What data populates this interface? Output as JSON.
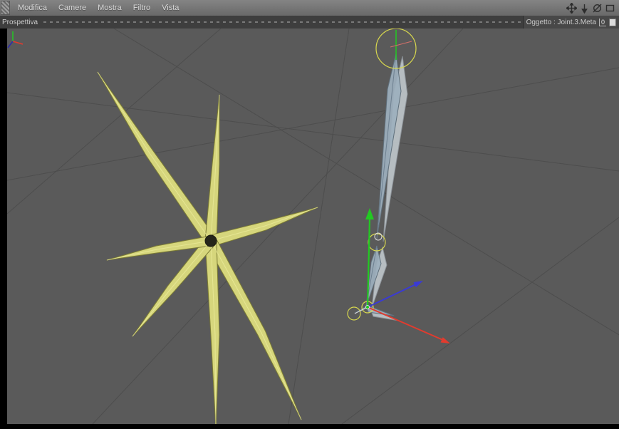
{
  "menubar": {
    "items": [
      {
        "label": "Modifica"
      },
      {
        "label": "Camere"
      },
      {
        "label": "Mostra"
      },
      {
        "label": "Filtro"
      },
      {
        "label": "Vista"
      }
    ],
    "nav_icons": [
      {
        "name": "pan-icon"
      },
      {
        "name": "dolly-icon"
      },
      {
        "name": "rotate-icon"
      },
      {
        "name": "maximize-icon"
      }
    ]
  },
  "viewbar": {
    "view_label": "Prospettiva",
    "object_info": "Oggetto : Joint.3.Meta",
    "layer_badge": "0"
  },
  "scene": {
    "objects": [
      {
        "name": "spline-star"
      },
      {
        "name": "joint-chain"
      }
    ],
    "colors": {
      "viewport_bg": "#5a5a5a",
      "grid_line": "#4c4c4c",
      "spline_fill": "#d6d67c",
      "spline_edge": "#7c7c34",
      "bone_fill": "#9db0be",
      "bone_ghost": "#c7cfd4",
      "selection_ring": "#d8d84e",
      "axis_x": "#e23b2e",
      "axis_y": "#22c922",
      "axis_z": "#3a3ad6"
    }
  }
}
